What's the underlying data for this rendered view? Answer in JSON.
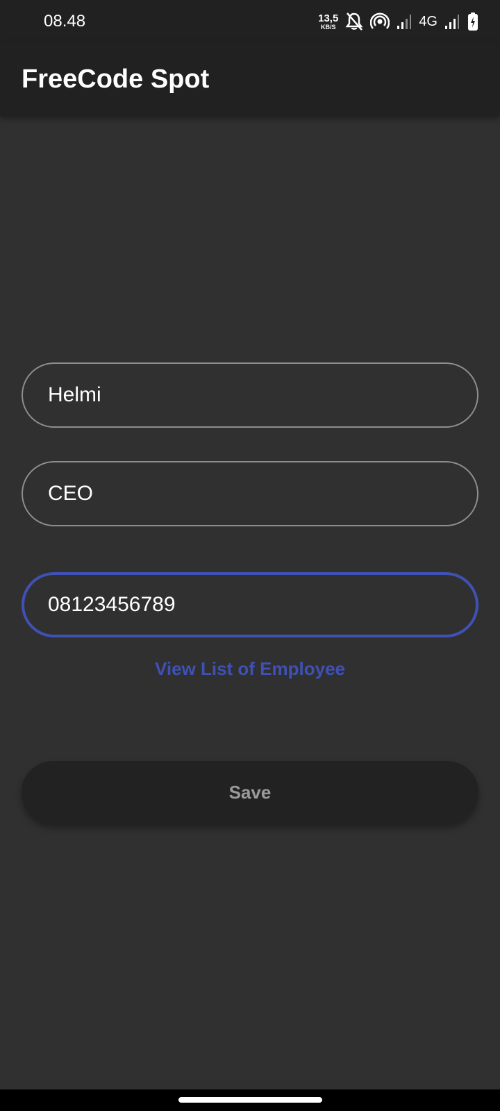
{
  "status_bar": {
    "time": "08.48",
    "net_speed_value": "13,5",
    "net_speed_unit": "KB/S",
    "network_type": "4G",
    "icons": [
      "bell-off-icon",
      "hotspot-icon",
      "signal-icon",
      "signal-icon",
      "battery-charging-icon"
    ]
  },
  "app_bar": {
    "title": "FreeCode Spot"
  },
  "form": {
    "name_value": "Helmi",
    "position_value": "CEO",
    "phone_value": "08123456789",
    "view_list_label": "View List of Employee",
    "save_label": "Save"
  },
  "colors": {
    "accent": "#3f51b5",
    "background": "#303030",
    "app_bar": "#212121",
    "button": "#222222"
  }
}
